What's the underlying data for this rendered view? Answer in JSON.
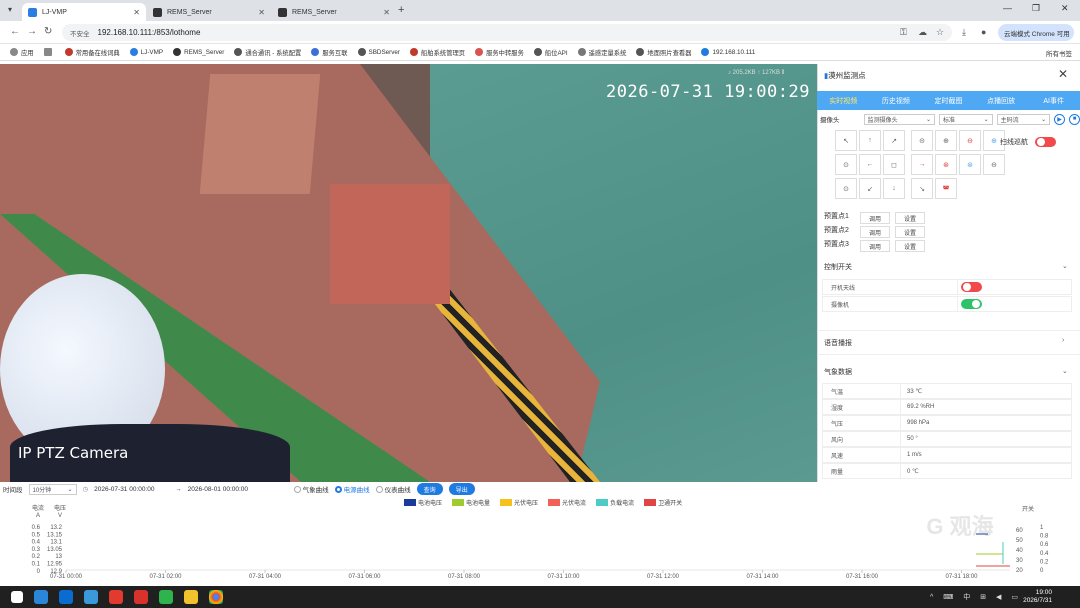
{
  "browser": {
    "tabs": [
      {
        "label": "LJ-VMP",
        "active": true,
        "color": "#2a7de1"
      },
      {
        "label": "REMS_Server",
        "active": false,
        "color": "#333333"
      },
      {
        "label": "REMS_Server",
        "active": false,
        "color": "#333333"
      }
    ],
    "new_tab": "+",
    "security": "不安全",
    "url": "192.168.10.111:/853/lothome",
    "profile": "云端模式 Chrome 可用",
    "bookmarks": [
      "应用",
      "",
      "常用备在线词典",
      "LJ-VMP",
      "REMS_Server",
      "通合通讯 - 系统配置",
      "服务互联",
      "SBDServer",
      "船舶系统管理页",
      "服务中转服务",
      "船位API",
      "遥感定量系统",
      "地面照片查看器",
      "192.168.10.111"
    ],
    "all_bookmarks": "所有书签"
  },
  "video": {
    "timestamp": "2026-07-31 19:00:29",
    "camera_label": "IP PTZ Camera",
    "stats": "♪ 205.2KB   ↑ 127KB   ⫴"
  },
  "panel": {
    "title": "漠州监测点",
    "tabs": [
      "实时视频",
      "历史视频",
      "定时截图",
      "点播回放",
      "AI事件"
    ],
    "camera_label": "摄像头",
    "camera_select": "监测摄像头",
    "quality_select": "标准",
    "stream_select": "主码流",
    "patrol_label": "扫线巡航",
    "ptz_buttons": [
      "↖",
      "↑",
      "↗",
      "⊝",
      "⊕",
      "⊖",
      "⊕",
      "⊙",
      "←",
      "◻",
      "→",
      "⊛",
      "⊛",
      "⊖",
      "⊙",
      "↙",
      "↓",
      "↘",
      "◚",
      "◓"
    ],
    "presets": [
      {
        "label": "预置点1",
        "call": "调用",
        "set": "设置"
      },
      {
        "label": "预置点2",
        "call": "调用",
        "set": "设置"
      },
      {
        "label": "预置点3",
        "call": "调用",
        "set": "设置"
      }
    ],
    "switch_section": "控制开关",
    "switches": [
      {
        "label": "开机天线",
        "on": false
      },
      {
        "label": "摄像机",
        "on": true
      }
    ],
    "voice_section": "语音播报",
    "weather_section": "气象数据",
    "weather": [
      {
        "k": "气温",
        "v": "33 ℃"
      },
      {
        "k": "湿度",
        "v": "69.2 %RH"
      },
      {
        "k": "气压",
        "v": "998 hPa"
      },
      {
        "k": "风向",
        "v": "50 °"
      },
      {
        "k": "风速",
        "v": "1 m/s"
      },
      {
        "k": "雨量",
        "v": "0 ℃"
      }
    ]
  },
  "filter": {
    "time_label": "时间段",
    "range_select": "10分钟",
    "start": "2026-07-31 00:00:00",
    "arrow": "→",
    "end": "2026-08-01 00:00:00",
    "radios": [
      {
        "label": "气象曲线",
        "on": false
      },
      {
        "label": "电源曲线",
        "on": true
      },
      {
        "label": "仪表曲线",
        "on": false
      }
    ],
    "query_btn": "查询",
    "export_btn": "导出"
  },
  "chart_data": {
    "type": "line",
    "legend": [
      {
        "name": "电池电压",
        "color": "#1a3a9c"
      },
      {
        "name": "电池电量",
        "color": "#9fcb2f"
      },
      {
        "name": "光伏电压",
        "color": "#f5c11a"
      },
      {
        "name": "光伏电流",
        "color": "#f2605a"
      },
      {
        "name": "负载电流",
        "color": "#4dcbc7"
      },
      {
        "name": "卫通开关",
        "color": "#e04444"
      }
    ],
    "left_axes": [
      {
        "title": "电流\nA",
        "ticks": [
          "0.6",
          "0.5",
          "0.4",
          "0.3",
          "0.2",
          "0.1",
          "0"
        ]
      },
      {
        "title": "电压\nV",
        "ticks": [
          "13.2",
          "13.15",
          "13.1",
          "13.05",
          "13",
          "12.95",
          "12.9"
        ]
      }
    ],
    "right_axes": [
      {
        "title": "开关",
        "ticks": [
          "1",
          "0.8",
          "0.6",
          "0.4",
          "0.2",
          "0"
        ]
      },
      {
        "title": "",
        "ticks": [
          "60",
          "50",
          "40",
          "30",
          "20"
        ]
      }
    ],
    "x_ticks": [
      "07-31 00:00",
      "07-31 02:00",
      "07-31 04:00",
      "07-31 06:00",
      "07-31 08:00",
      "07-31 10:00",
      "07-31 12:00",
      "07-31 14:00",
      "07-31 16:00",
      "07-31 18:00"
    ],
    "watermark": "G 观海"
  },
  "taskbar": {
    "time": "19:00",
    "date": "2026/7/31",
    "tray": "^ ⌨ 中 ⊞ ◀ ▭"
  }
}
